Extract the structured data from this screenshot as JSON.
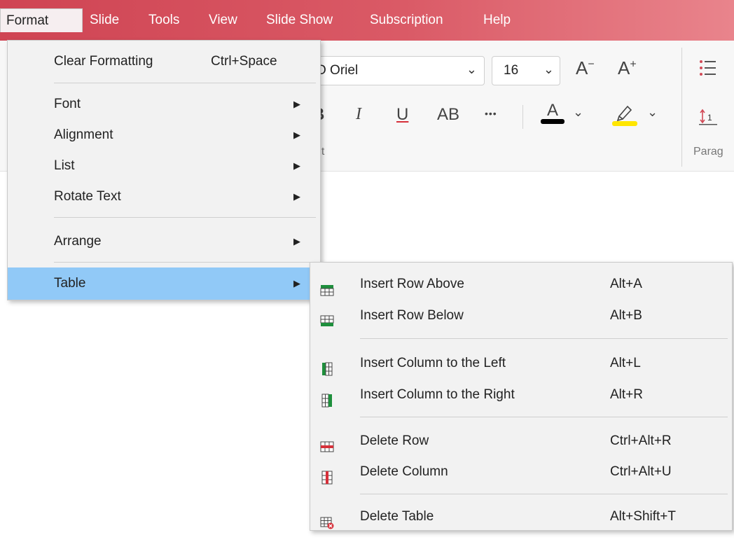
{
  "menubar": {
    "items": [
      {
        "label": "Format",
        "active": true
      },
      {
        "label": "Slide"
      },
      {
        "label": "Tools"
      },
      {
        "label": "View"
      },
      {
        "label": "Slide Show"
      },
      {
        "label": "Subscription"
      },
      {
        "label": "Help"
      }
    ]
  },
  "ribbon": {
    "font_value": "O Oriel",
    "font_size_value": "16",
    "group_font_partial": "nt",
    "group_paragraph_partial": "Parag",
    "buttons": {
      "decrease_font": "A",
      "increase_font": "A",
      "bold_partial": "B",
      "italic": "I",
      "underline": "U",
      "all_caps": "AB",
      "more": "•••",
      "font_color": "A"
    },
    "colors": {
      "font_color_bar": "#000000",
      "highlight_bar": "#ffe600"
    }
  },
  "format_menu": {
    "items": [
      {
        "label": "Clear Formatting",
        "shortcut": "Ctrl+Space"
      },
      {
        "label": "Font",
        "submenu": true
      },
      {
        "label": "Alignment",
        "submenu": true
      },
      {
        "label": "List",
        "submenu": true
      },
      {
        "label": "Rotate Text",
        "submenu": true
      },
      {
        "label": "Arrange",
        "submenu": true
      },
      {
        "label": "Table",
        "submenu": true,
        "highlighted": true
      }
    ]
  },
  "table_menu": {
    "items": [
      {
        "label": "Insert Row Above",
        "shortcut": "Alt+A",
        "icon": "insert-row-above-icon"
      },
      {
        "label": "Insert Row Below",
        "shortcut": "Alt+B",
        "icon": "insert-row-below-icon"
      },
      {
        "label": "Insert Column to the Left",
        "shortcut": "Alt+L",
        "icon": "insert-column-left-icon"
      },
      {
        "label": "Insert Column to the Right",
        "shortcut": "Alt+R",
        "icon": "insert-column-right-icon"
      },
      {
        "label": "Delete Row",
        "shortcut": "Ctrl+Alt+R",
        "icon": "delete-row-icon"
      },
      {
        "label": "Delete Column",
        "shortcut": "Ctrl+Alt+U",
        "icon": "delete-column-icon"
      },
      {
        "label": "Delete Table",
        "shortcut": "Alt+Shift+T",
        "icon": "delete-table-icon"
      }
    ]
  },
  "theme": {
    "menubar_red": "#d24a57",
    "menu_highlight": "#91c9f7",
    "icon_green": "#1e8f3c",
    "icon_red": "#d6303a"
  }
}
